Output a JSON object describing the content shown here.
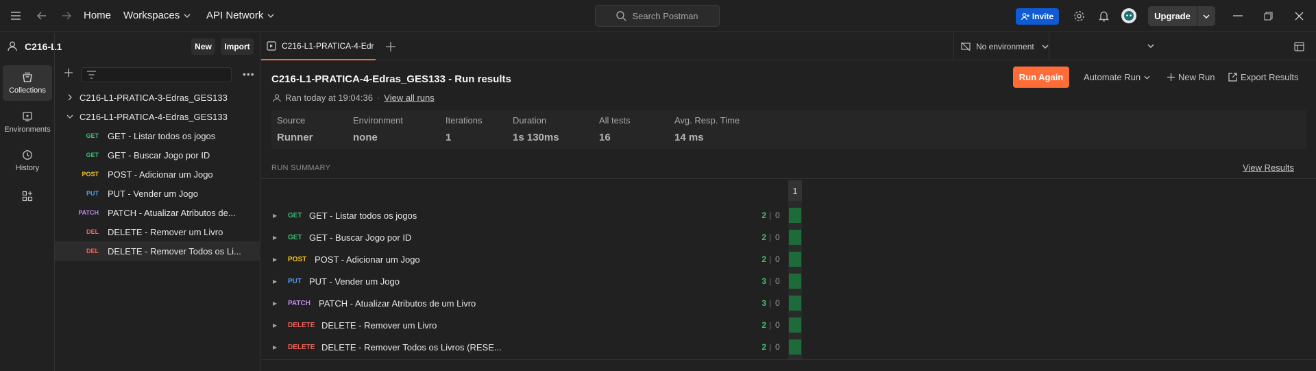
{
  "topbar": {
    "home": "Home",
    "workspaces": "Workspaces",
    "api_network": "API Network",
    "search_placeholder": "Search Postman",
    "invite": "Invite",
    "upgrade": "Upgrade"
  },
  "workspace": {
    "name": "C216-L1",
    "new_label": "New",
    "import_label": "Import"
  },
  "rail": [
    {
      "label": "Collections",
      "icon": "collections-icon"
    },
    {
      "label": "Environments",
      "icon": "environments-icon"
    },
    {
      "label": "History",
      "icon": "history-icon"
    }
  ],
  "sidebar": {
    "collections": [
      {
        "name": "C216-L1-PRATICA-3-Edras_GES133",
        "expanded": false
      },
      {
        "name": "C216-L1-PRATICA-4-Edras_GES133",
        "expanded": true
      }
    ],
    "requests": [
      {
        "method": "GET",
        "name": "GET - Listar todos os jogos"
      },
      {
        "method": "GET",
        "name": "GET - Buscar Jogo por ID"
      },
      {
        "method": "POST",
        "name": "POST - Adicionar um Jogo"
      },
      {
        "method": "PUT",
        "name": "PUT - Vender um Jogo"
      },
      {
        "method": "PATCH",
        "name": "PATCH - Atualizar Atributos de..."
      },
      {
        "method": "DEL",
        "name": "DELETE - Remover um Livro"
      },
      {
        "method": "DEL",
        "name": "DELETE - Remover Todos os Li..."
      }
    ]
  },
  "tabs": {
    "active": "C216-L1-PRATICA-4-Edr",
    "environment": "No environment"
  },
  "run": {
    "title": "C216-L1-PRATICA-4-Edras_GES133 - Run results",
    "ran_at": "Ran today at 19:04:36",
    "dot": "·",
    "view_all_runs": "View all runs",
    "run_again": "Run Again",
    "automate_run": "Automate Run",
    "new_run": "New Run",
    "export_results": "Export Results",
    "stats": [
      {
        "label": "Source",
        "value": "Runner"
      },
      {
        "label": "Environment",
        "value": "none"
      },
      {
        "label": "Iterations",
        "value": "1"
      },
      {
        "label": "Duration",
        "value": "1s 130ms"
      },
      {
        "label": "All tests",
        "value": "16"
      },
      {
        "label": "Avg. Resp. Time",
        "value": "14 ms"
      }
    ],
    "summary_label": "RUN SUMMARY",
    "view_results": "View Results",
    "iteration_header": "1",
    "requests": [
      {
        "method": "GET",
        "name": "GET - Listar todos os jogos",
        "pass": "2",
        "fail": "0"
      },
      {
        "method": "GET",
        "name": "GET - Buscar Jogo por ID",
        "pass": "2",
        "fail": "0"
      },
      {
        "method": "POST",
        "name": "POST - Adicionar um Jogo",
        "pass": "2",
        "fail": "0"
      },
      {
        "method": "PUT",
        "name": "PUT - Vender um Jogo",
        "pass": "3",
        "fail": "0"
      },
      {
        "method": "PATCH",
        "name": "PATCH - Atualizar Atributos de um Livro",
        "pass": "3",
        "fail": "0"
      },
      {
        "method": "DELETE",
        "name": "DELETE - Remover um Livro",
        "pass": "2",
        "fail": "0"
      },
      {
        "method": "DELETE",
        "name": "DELETE - Remover Todos os Livros (RESE...",
        "pass": "2",
        "fail": "0"
      }
    ]
  }
}
